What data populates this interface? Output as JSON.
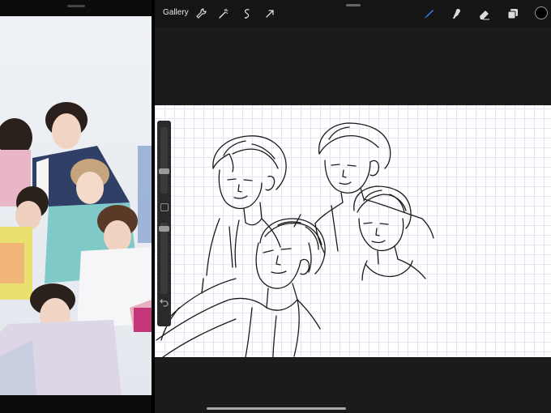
{
  "toolbar": {
    "gallery_label": "Gallery",
    "left_tools": [
      "wrench-icon",
      "magic-wand-icon",
      "selection-icon",
      "transform-arrow-icon"
    ],
    "right_tools": [
      "brush-icon",
      "smudge-icon",
      "eraser-icon",
      "layers-icon"
    ],
    "active_tool": "brush-icon",
    "active_color": "#000000",
    "accent_color": "#3b7ff5"
  },
  "sidebar": {
    "brush_size_level": 0.27,
    "opacity_level": 0.09
  },
  "reference_pane": {
    "background": "#e8ecf1"
  },
  "canvas": {
    "background": "#ffffff",
    "grid_color": "#dfe7f2",
    "stroke_color": "#1a1a1a"
  }
}
